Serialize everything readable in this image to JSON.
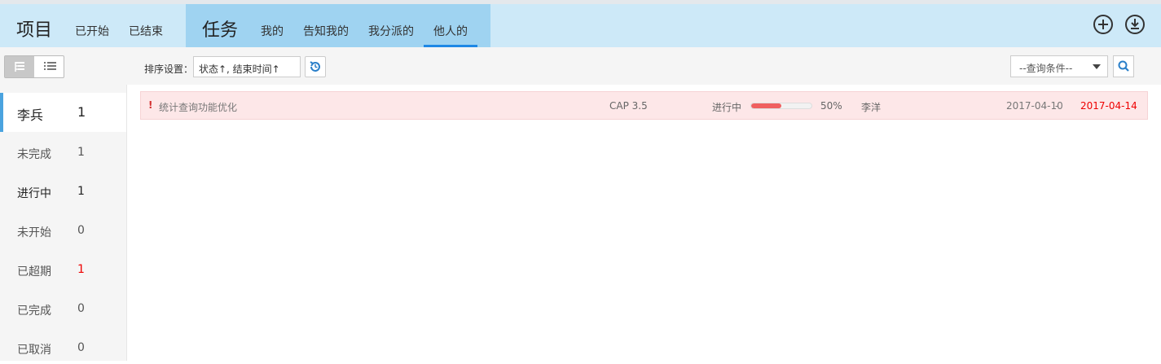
{
  "header": {
    "project_title": "项目",
    "project_nav": [
      "已开始",
      "已结束"
    ],
    "task_title": "任务",
    "task_nav": [
      "我的",
      "告知我的",
      "我分派的",
      "他人的"
    ],
    "active_tab": "他人的",
    "actions": [
      {
        "name": "add",
        "icon": "plus-circle-icon"
      },
      {
        "name": "download",
        "icon": "download-circle-icon"
      }
    ]
  },
  "toolbar": {
    "view_modes": [
      {
        "icon": "tree-view-icon",
        "active": true
      },
      {
        "icon": "list-view-icon",
        "active": false
      }
    ],
    "sort_label": "排序设置：",
    "sort_value": "状态↑, 结束时间↑",
    "reset_icon": "refresh-icon",
    "query_placeholder": "--查询条件--",
    "search_icon": "search-icon"
  },
  "sidebar": {
    "person": {
      "name": "李兵",
      "count": "1"
    },
    "items": [
      {
        "label": "未完成",
        "count": "1"
      },
      {
        "label": "进行中",
        "count": "1"
      },
      {
        "label": "未开始",
        "count": "0"
      },
      {
        "label": "已超期",
        "count": "1"
      },
      {
        "label": "已完成",
        "count": "0"
      },
      {
        "label": "已取消",
        "count": "0"
      }
    ]
  },
  "tasks": [
    {
      "flag": "!",
      "title": "统计查询功能优化",
      "project": "CAP 3.5",
      "status": "进行中",
      "progress": 0.5,
      "progress_text": "50%",
      "owner": "李洋",
      "start": "2017-04-10",
      "dash": "-",
      "end": "2017-04-14"
    }
  ],
  "colors": {
    "header_bg": "#cde9f8",
    "task_area_bg": "#9fd3f1",
    "accent": "#1e88e5",
    "row_bg": "#fde7e8",
    "overdue": "#ee0000",
    "progress": "#f06060"
  }
}
